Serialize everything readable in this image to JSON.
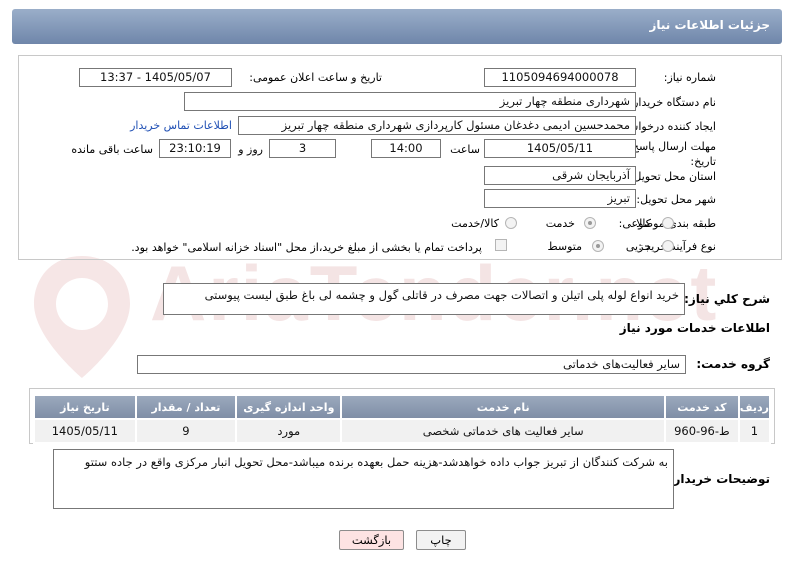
{
  "header": {
    "title": "جزئیات اطلاعات نیاز"
  },
  "labels": {
    "need_number": "شماره نیاز:",
    "announce_datetime": "تاریخ و ساعت اعلان عمومی:",
    "buyer_org": "نام دستگاه خریدار:",
    "requester": "ایجاد کننده درخواست:",
    "buyer_contact": "اطلاعات تماس خریدار",
    "deadline_line1": "مهلت ارسال پاسخ: تا",
    "deadline_line2": "تاریخ:",
    "time_word": "ساعت",
    "day_and": "روز و",
    "remaining": "ساعت باقی مانده",
    "delivery_province": "استان محل تحویل:",
    "delivery_city": "شهر محل تحویل:",
    "category": "طبقه بندی موضوعی:",
    "purchase_type": "نوع فرآیند خرید :",
    "general_desc": "شرح کلي نياز:",
    "services_info": "اطلاعات خدمات مورد نياز",
    "service_group": "گروه خدمت:",
    "buyer_notes": "توضیحات خریدار:"
  },
  "values": {
    "need_number": "1105094694000078",
    "announce_datetime": "1405/05/07 - 13:37",
    "buyer_org": "شهرداری منطقه چهار تبریز",
    "requester": "محمدحسین ادیمی دغدغان مسئول کارپردازی شهرداری منطقه چهار تبریز",
    "deadline_date": "1405/05/11",
    "deadline_time": "14:00",
    "days": "3",
    "remaining_time": "23:10:19",
    "province": "آذربایجان شرقی",
    "city": "تبریز",
    "general_desc": "خرید انواع لوله پلی اتیلن و اتصالات جهت مصرف در قاتلی گول و چشمه لی باغ طبق لیست پیوستی",
    "service_group": "سایر فعالیت‌های خدماتی",
    "buyer_notes": "به شرکت کنندگان از تبریز جواب داده خواهدشد-هزینه حمل بعهده برنده میباشد-محل تحویل انبار مرکزی واقع در جاده ستتو"
  },
  "category_options": {
    "goods": "کالا",
    "service": "خدمت",
    "goods_service": "کالا/خدمت",
    "selected": "service"
  },
  "purchase_options": {
    "partial": "جزیی",
    "medium": "متوسط",
    "selected": "medium",
    "treasury_note": "پرداخت تمام یا بخشی از مبلغ خرید،از محل \"اسناد خزانه اسلامی\" خواهد بود."
  },
  "table": {
    "headers": [
      "ردیف",
      "کد خدمت",
      "نام خدمت",
      "واحد اندازه گیری",
      "تعداد / مقدار",
      "تاریخ نیاز"
    ],
    "rows": [
      [
        "1",
        "ط-96-960",
        "سایر فعالیت های خدماتی شخصی",
        "مورد",
        "9",
        "1405/05/11"
      ]
    ]
  },
  "buttons": {
    "print": "چاپ",
    "back": "بازگشت"
  },
  "watermark": "AriaTender.net",
  "colors": {
    "header": "#7d93b4",
    "link": "#1f4fb4",
    "back_button": "#fde3e3",
    "print_button": "#f2f2f2"
  }
}
